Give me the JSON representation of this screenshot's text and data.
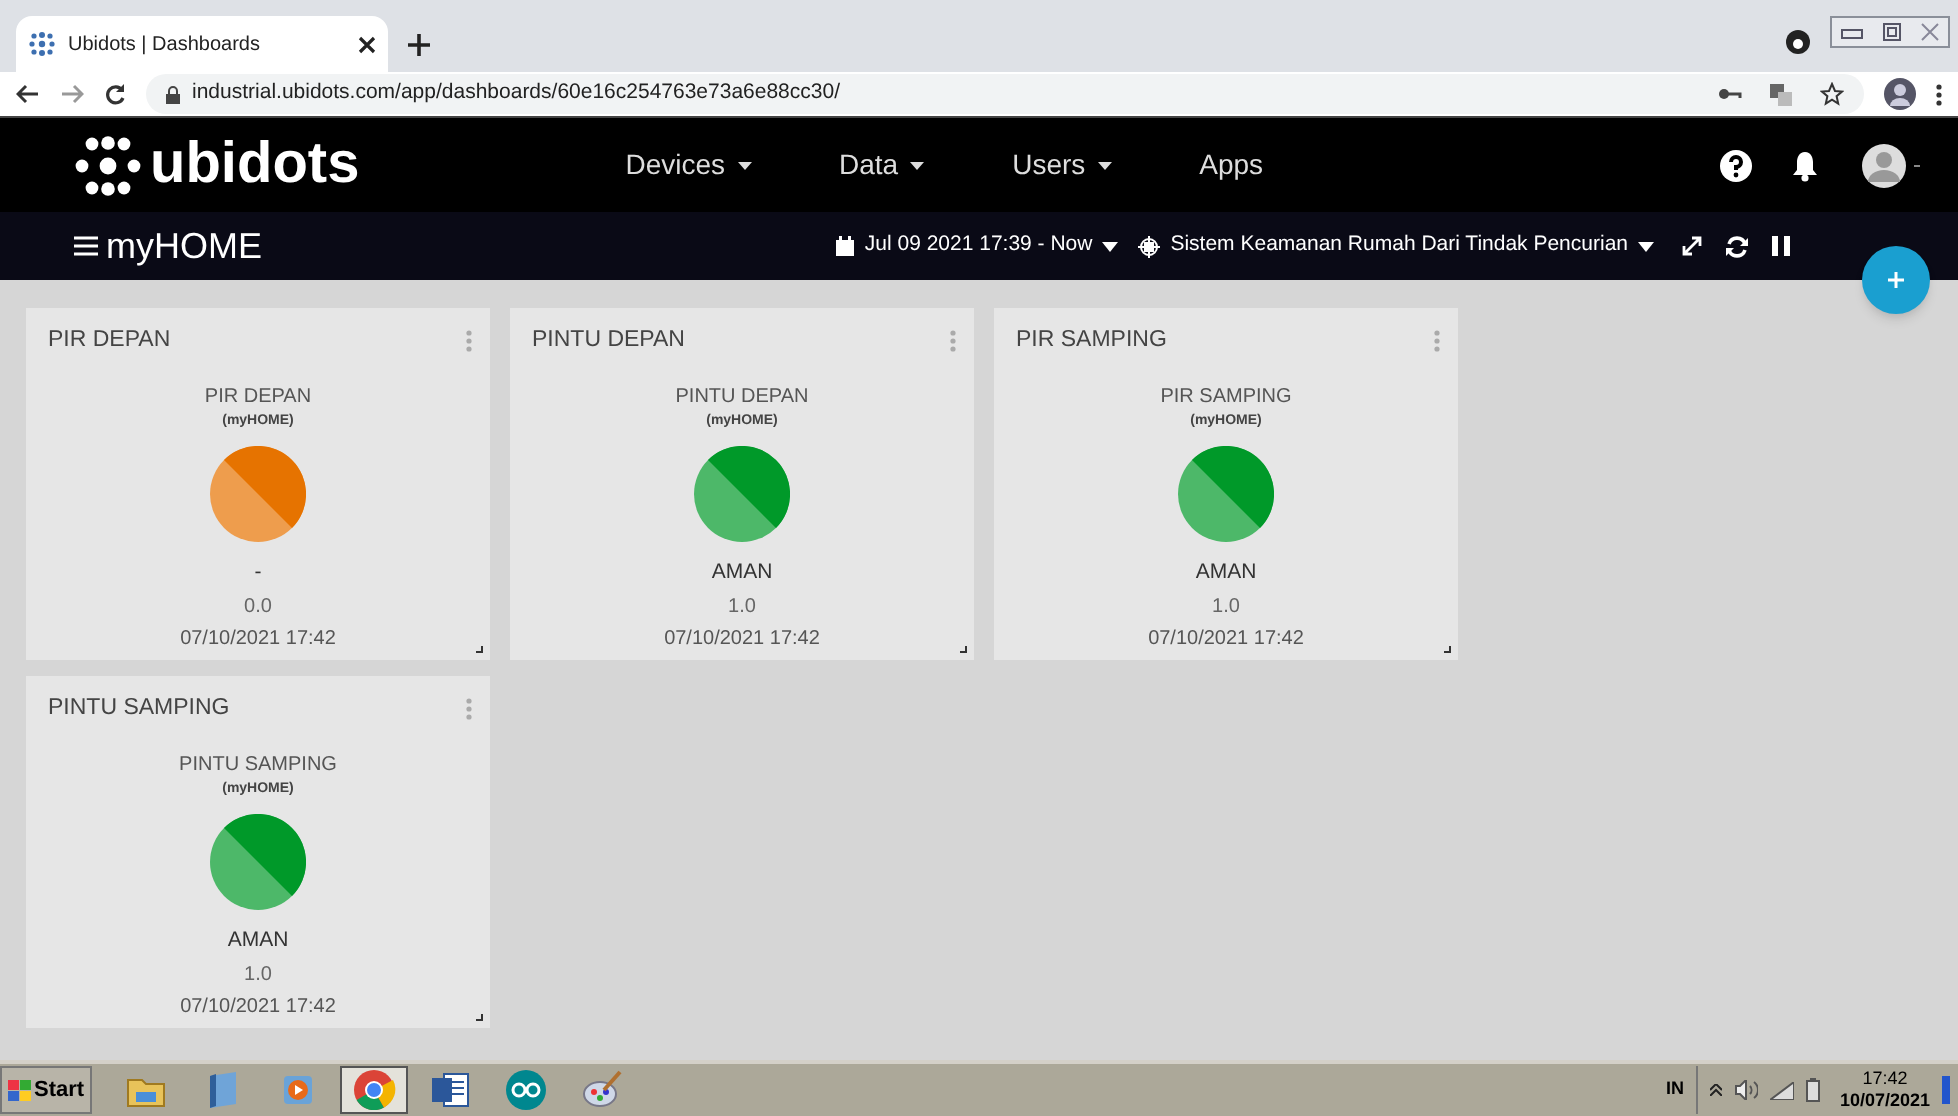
{
  "browser": {
    "tab_title": "Ubidots | Dashboards",
    "url": "industrial.ubidots.com/app/dashboards/60e16c254763e73a6e88cc30/"
  },
  "header": {
    "logo": "ubidots",
    "nav": [
      {
        "label": "Devices",
        "dropdown": true
      },
      {
        "label": "Data",
        "dropdown": true
      },
      {
        "label": "Users",
        "dropdown": true
      },
      {
        "label": "Apps",
        "dropdown": false
      }
    ]
  },
  "toolbar": {
    "dashboard": "myHOME",
    "date_range": "Jul 09 2021 17:39 - Now",
    "device_filter": "Sistem Keamanan Rumah Dari Tindak Pencurian"
  },
  "widgets": [
    {
      "title": "PIR DEPAN",
      "device": "PIR DEPAN",
      "context": "(myHOME)",
      "color": "#e67300",
      "status": "-",
      "value": "0.0",
      "time": "07/10/2021 17:42"
    },
    {
      "title": "PINTU DEPAN",
      "device": "PINTU DEPAN",
      "context": "(myHOME)",
      "color": "#009929",
      "status": "AMAN",
      "value": "1.0",
      "time": "07/10/2021 17:42"
    },
    {
      "title": "PIR SAMPING",
      "device": "PIR SAMPING",
      "context": "(myHOME)",
      "color": "#009929",
      "status": "AMAN",
      "value": "1.0",
      "time": "07/10/2021 17:42"
    },
    {
      "title": "PINTU SAMPING",
      "device": "PINTU SAMPING",
      "context": "(myHOME)",
      "color": "#009929",
      "status": "AMAN",
      "value": "1.0",
      "time": "07/10/2021 17:42"
    }
  ],
  "taskbar": {
    "start": "Start",
    "apps": [
      {
        "kind": "folder",
        "selected": false
      },
      {
        "kind": "notepad",
        "selected": false
      },
      {
        "kind": "media",
        "selected": false
      },
      {
        "kind": "chrome",
        "selected": true
      },
      {
        "kind": "word",
        "selected": false
      },
      {
        "kind": "arduino",
        "selected": false
      },
      {
        "kind": "paint",
        "selected": false
      }
    ],
    "language": "IN",
    "time": "17:42",
    "date": "10/07/2021"
  }
}
